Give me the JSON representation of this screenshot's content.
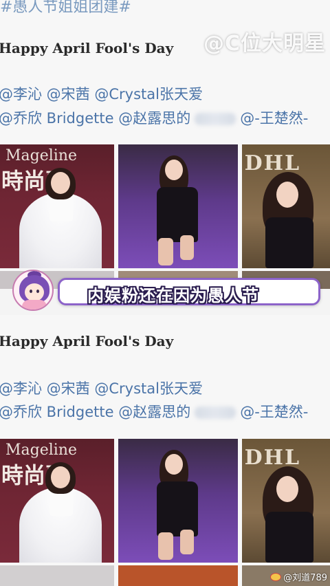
{
  "top": {
    "hashtag": "#愚人节姐姐团建#",
    "watermark": "@C位大明星",
    "title": "Happy April Fool's Day",
    "mentions_line1": "@李沁 @宋茜 @Crystal张天爱",
    "mentions_line2_a": "@乔欣 Bridgette @赵露思的",
    "mentions_line2_b": "@-王楚然-",
    "photo1_brand_en": "Mageline",
    "photo1_brand_cn": "時尚嘉",
    "photo3_brand": "DHL"
  },
  "caption": {
    "text": "内娱粉还在因为愚人节",
    "border_color": "#8c63c9"
  },
  "bottom": {
    "title": "Happy April Fool's Day",
    "mentions_line1": "@李沁 @宋茜 @Crystal张天爱",
    "mentions_line2_a": "@乔欣 Bridgette @赵露思的",
    "mentions_line2_b": "@-王楚然-",
    "photo1_brand_en": "Mageline",
    "photo1_brand_cn": "時尚嘉",
    "photo3_brand": "DHL"
  },
  "credit": {
    "text": "@刘道789"
  }
}
